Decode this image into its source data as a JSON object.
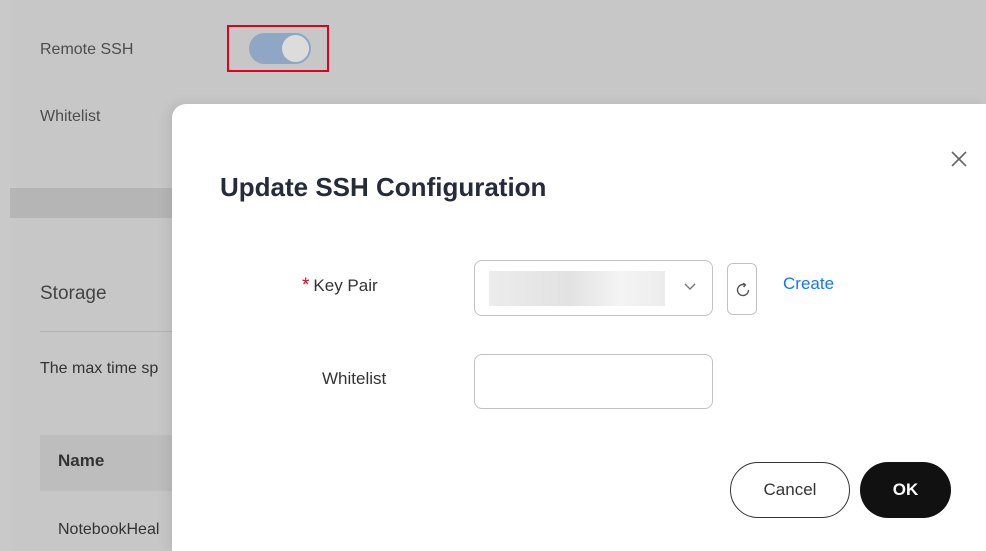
{
  "background": {
    "remote_ssh_label": "Remote SSH",
    "remote_ssh_enabled": true,
    "whitelist_label": "Whitelist",
    "storage_title": "Storage",
    "storage_description": "The max time sp",
    "table": {
      "headers": [
        "Name"
      ],
      "rows": [
        [
          "NotebookHeal"
        ]
      ]
    }
  },
  "dialog": {
    "title": "Update SSH Configuration",
    "close_icon": "close-icon",
    "key_pair": {
      "label": "Key Pair",
      "required_mark": "*",
      "selected_value": "",
      "refresh_icon": "refresh-icon",
      "create_link": "Create"
    },
    "whitelist": {
      "label": "Whitelist",
      "value": ""
    },
    "buttons": {
      "cancel": "Cancel",
      "ok": "OK"
    }
  },
  "colors": {
    "accent_link": "#1476ff",
    "required": "#e0001b",
    "primary_button": "#111111",
    "highlight_box": "#e0001b"
  }
}
